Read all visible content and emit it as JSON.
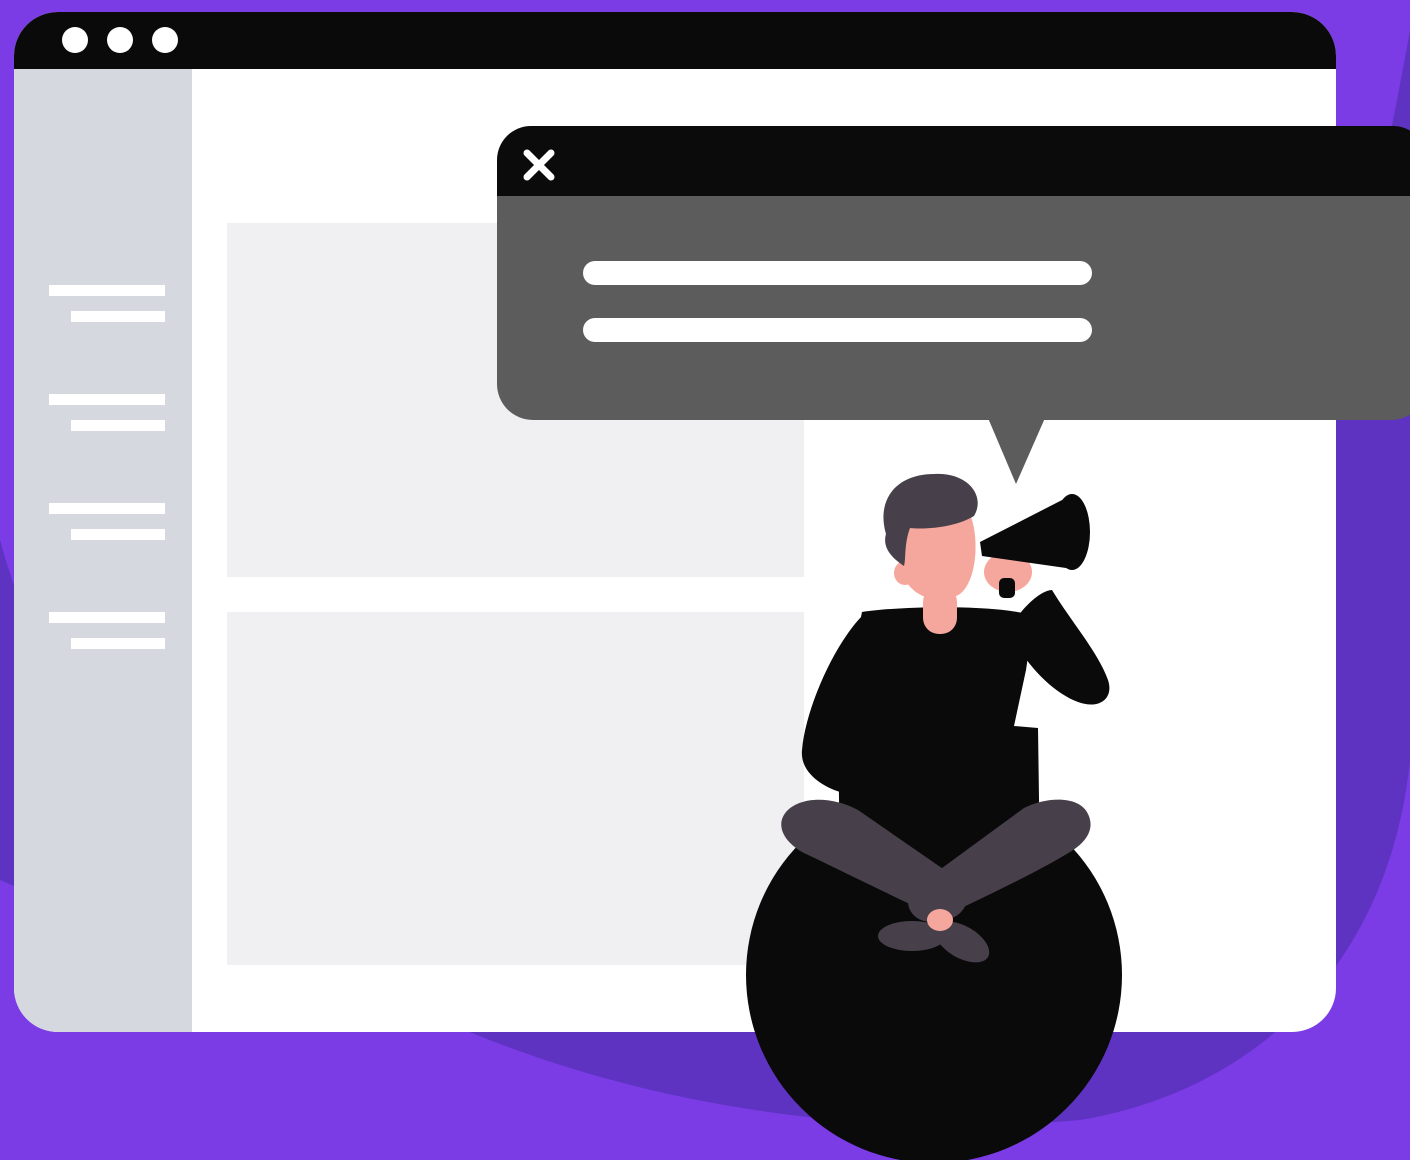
{
  "colors": {
    "background": "#7b3ce6",
    "background_swoosh": "#5f33c2",
    "titlebar": "#0a0a0a",
    "window": "#ffffff",
    "sidebar": "#d6d8e0",
    "panel": "#f0f0f2",
    "popup_header": "#0b0b0b",
    "popup_body": "#5c5c5c",
    "skin": "#f6a79d",
    "hair_and_pants": "#47404a",
    "clothing": "#0a0a0a"
  },
  "icons": {
    "window_controls": [
      "window-dot-icon",
      "window-dot-icon",
      "window-dot-icon"
    ],
    "close": "close-icon",
    "megaphone": "megaphone-icon"
  },
  "sidebar": {
    "items": [
      "menu-item",
      "menu-item",
      "menu-item",
      "menu-item"
    ]
  },
  "popup": {
    "text_lines": [
      "text-placeholder",
      "text-placeholder"
    ]
  }
}
